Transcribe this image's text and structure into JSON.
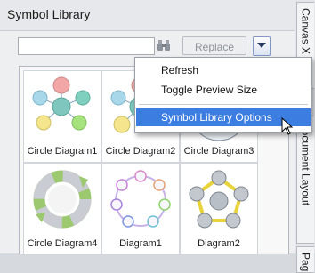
{
  "panel": {
    "title": "Symbol Library",
    "search": {
      "value": "",
      "placeholder": ""
    },
    "replace_label": "Replace"
  },
  "symbols": [
    {
      "label": "Circle Diagram1",
      "icon": "circle-diagram-radial-icon"
    },
    {
      "label": "Circle Diagram2",
      "icon": "circle-diagram-radial-icon"
    },
    {
      "label": "Circle Diagram3",
      "icon": "circle-diagram-icon"
    },
    {
      "label": "Circle Diagram4",
      "icon": "cycle-arrows-icon"
    },
    {
      "label": "Diagram1",
      "icon": "ring-diagram-icon"
    },
    {
      "label": "Diagram2",
      "icon": "pentagon-cycle-icon"
    }
  ],
  "dropdown": {
    "items": [
      {
        "label": "Refresh"
      },
      {
        "label": "Toggle Preview Size"
      },
      {
        "label": "Symbol Library Options"
      }
    ]
  },
  "tabs": [
    {
      "label": "Canvas X"
    },
    {
      "label": "Document Layout"
    },
    {
      "label": "Pag"
    }
  ],
  "colors": {
    "menu_highlight": "#3b7de1",
    "node_pink": "#f3a6a6",
    "node_green": "#a6e37e",
    "node_teal": "#7fc7be"
  }
}
